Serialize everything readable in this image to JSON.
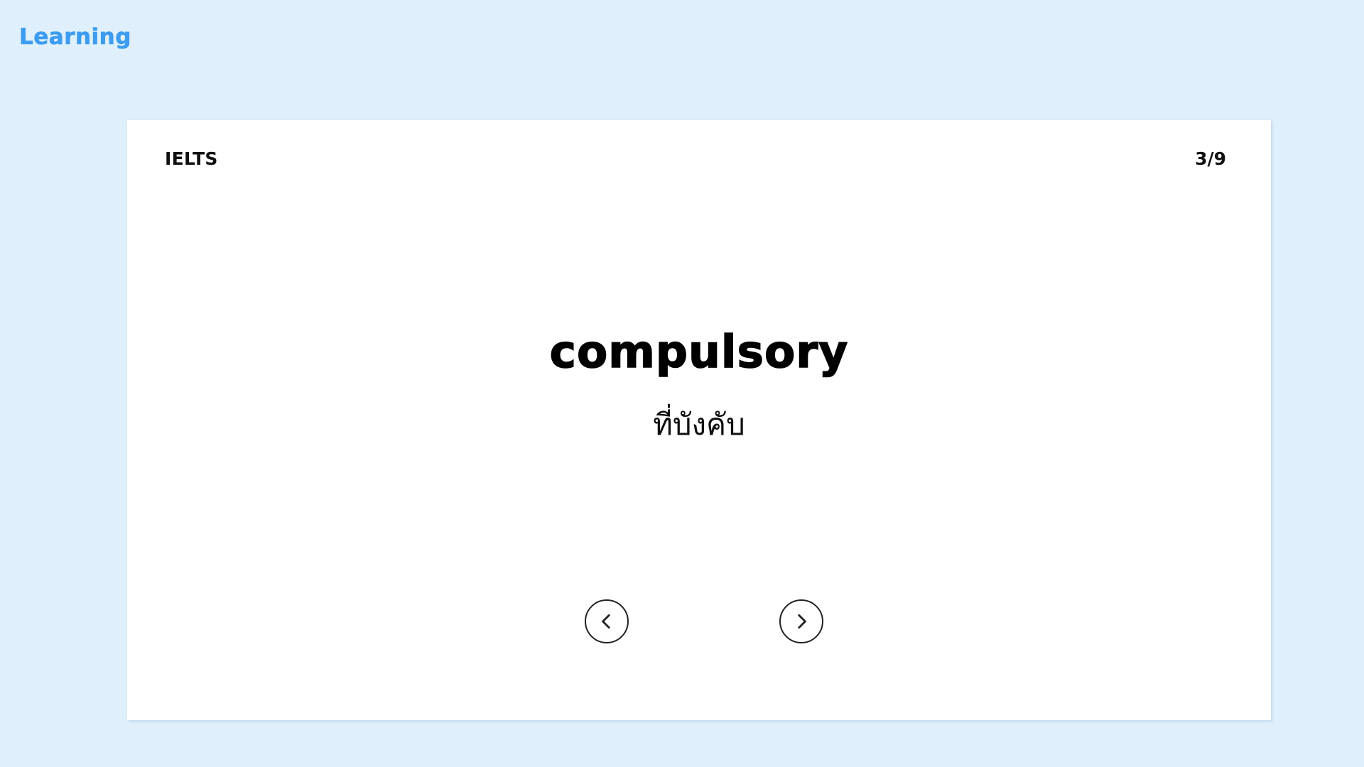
{
  "app": {
    "brand": "Learning",
    "brand_color": "#3d9cf0",
    "background_color": "#dff0fc"
  },
  "flashcard": {
    "deck_name": "IELTS",
    "progress": "3/9",
    "current_index": 3,
    "total_cards": 9,
    "word": "compulsory",
    "meaning": "ที่บังคับ"
  },
  "navigation": {
    "prev_icon": "chevron-left-icon",
    "next_icon": "chevron-right-icon"
  }
}
